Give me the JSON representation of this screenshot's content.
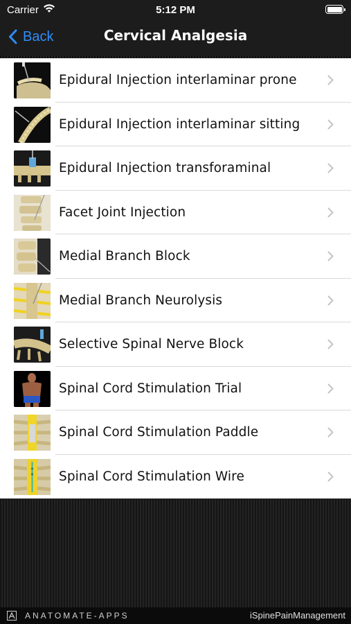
{
  "status_bar": {
    "carrier": "Carrier",
    "time": "5:12 PM"
  },
  "nav": {
    "back_label": "Back",
    "title": "Cervical Analgesia"
  },
  "list": {
    "items": [
      {
        "label": "Epidural Injection interlaminar prone"
      },
      {
        "label": "Epidural Injection interlaminar sitting"
      },
      {
        "label": "Epidural Injection transforaminal"
      },
      {
        "label": "Facet Joint Injection"
      },
      {
        "label": "Medial Branch Block"
      },
      {
        "label": "Medial Branch Neurolysis"
      },
      {
        "label": "Selective Spinal Nerve Block"
      },
      {
        "label": "Spinal Cord Stimulation Trial"
      },
      {
        "label": "Spinal Cord Stimulation Paddle"
      },
      {
        "label": "Spinal Cord Stimulation Wire"
      }
    ]
  },
  "footer": {
    "brand": "ANATOMATE-APPS",
    "app_name": "iSpinePainManagement"
  },
  "colors": {
    "accent": "#2f8dfb",
    "nav_background": "#1c1c1c",
    "list_background": "#ffffff"
  },
  "icons": {
    "back": "chevron-left-icon",
    "row_disclosure": "chevron-right-icon",
    "wifi": "wifi-icon",
    "battery": "battery-icon"
  }
}
